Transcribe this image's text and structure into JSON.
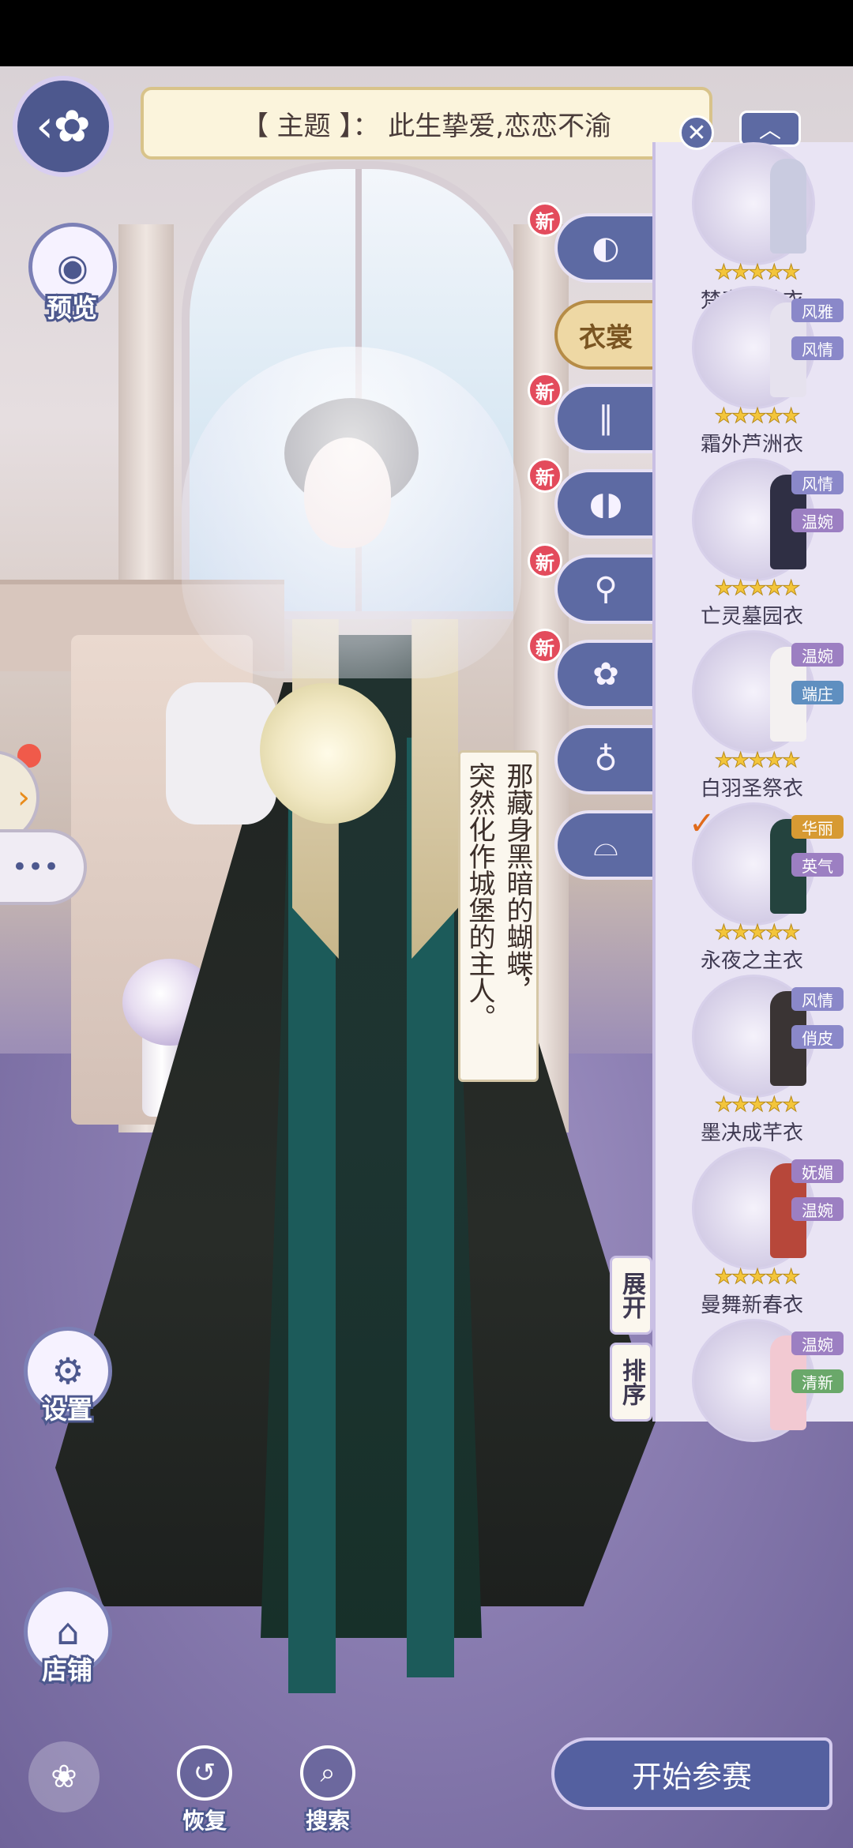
{
  "theme_banner": "【 主题 】：  此生挚爱,恋恋不渝",
  "left_controls": {
    "back_icon": "back-butterfly-icon",
    "preview_label": "预览",
    "settings_label": "设置",
    "shop_label": "店铺"
  },
  "categories": [
    {
      "icon": "hair-icon",
      "new_badge": "新",
      "label": ""
    },
    {
      "icon": "dress-icon",
      "new_badge": "",
      "label": "衣裳"
    },
    {
      "icon": "socks-icon",
      "new_badge": "新",
      "label": ""
    },
    {
      "icon": "shoes-icon",
      "new_badge": "新",
      "label": ""
    },
    {
      "icon": "earring-icon",
      "new_badge": "新",
      "label": ""
    },
    {
      "icon": "hairpin-icon",
      "new_badge": "新",
      "label": ""
    },
    {
      "icon": "scarf-icon",
      "new_badge": "",
      "label": ""
    },
    {
      "icon": "veil-icon",
      "new_badge": "",
      "label": ""
    }
  ],
  "dialog": {
    "line1": "那藏身黑暗的蝴蝶，",
    "line2": "突然化作城堡的主人。"
  },
  "wardrobe_panel": {
    "items": [
      {
        "name": "梵音幻蛇衣",
        "stars": 5,
        "tags": [],
        "selected": false,
        "color": "#c9cbe0"
      },
      {
        "name": "霜外芦洲衣",
        "stars": 5,
        "tags": [
          {
            "text": "风雅",
            "color": "#8a88c9"
          },
          {
            "text": "风情",
            "color": "#8a88c9"
          }
        ],
        "selected": false,
        "color": "#e6e2ee"
      },
      {
        "name": "亡灵墓园衣",
        "stars": 5,
        "tags": [
          {
            "text": "风情",
            "color": "#8a88c9"
          },
          {
            "text": "温婉",
            "color": "#9c7fc2"
          }
        ],
        "selected": false,
        "color": "#2f2f44"
      },
      {
        "name": "白羽圣祭衣",
        "stars": 5,
        "tags": [
          {
            "text": "温婉",
            "color": "#9c7fc2"
          },
          {
            "text": "端庄",
            "color": "#5f8fc0"
          }
        ],
        "selected": false,
        "color": "#f4f1f1"
      },
      {
        "name": "永夜之主衣",
        "stars": 5,
        "tags": [
          {
            "text": "华丽",
            "color": "#d79a33"
          },
          {
            "text": "英气",
            "color": "#9c7fc2"
          }
        ],
        "selected": true,
        "color": "#24433e"
      },
      {
        "name": "墨决成芊衣",
        "stars": 5,
        "tags": [
          {
            "text": "风情",
            "color": "#8a88c9"
          },
          {
            "text": "俏皮",
            "color": "#8a88c9"
          }
        ],
        "selected": false,
        "color": "#3a3434"
      },
      {
        "name": "曼舞新春衣",
        "stars": 5,
        "tags": [
          {
            "text": "妩媚",
            "color": "#9c7fc2"
          },
          {
            "text": "温婉",
            "color": "#9c7fc2"
          }
        ],
        "selected": false,
        "color": "#b7473a"
      },
      {
        "name": "",
        "stars": 0,
        "tags": [
          {
            "text": "温婉",
            "color": "#9c7fc2"
          },
          {
            "text": "清新",
            "color": "#6aa86a"
          }
        ],
        "selected": false,
        "color": "#f2c9d2"
      }
    ],
    "expand_label": "展开",
    "sort_label": "排序"
  },
  "bottom_bar": {
    "restore_label": "恢复",
    "search_label": "搜索",
    "start_label": "开始参赛"
  },
  "colors": {
    "accent": "#5460a0",
    "new_badge": "#e34b5c",
    "star": "#f3c53b"
  }
}
